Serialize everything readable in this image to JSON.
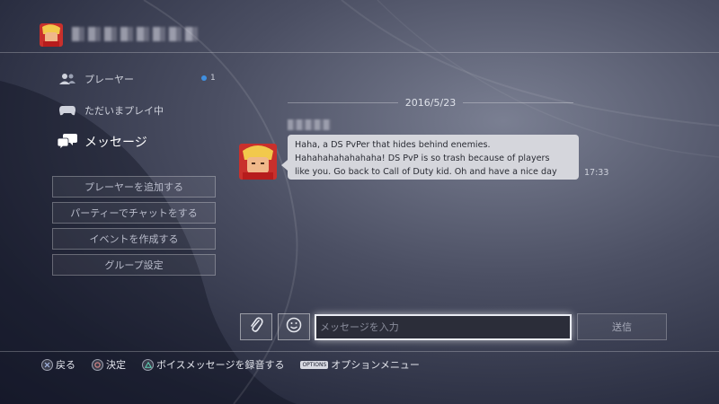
{
  "header": {
    "avatar": "ken-avatar"
  },
  "sidebar": {
    "players": {
      "label": "プレーヤー",
      "count": "1",
      "icon": "players-icon"
    },
    "now_playing": {
      "label": "ただいまプレイ中",
      "icon": "controller-icon"
    },
    "messages": {
      "label": "メッセージ",
      "icon": "message-bubbles-icon"
    },
    "buttons": [
      {
        "label": "プレーヤーを追加する"
      },
      {
        "label": "パーティーでチャットをする"
      },
      {
        "label": "イベントを作成する"
      },
      {
        "label": "グループ設定"
      }
    ]
  },
  "chat": {
    "date": "2016/5/23",
    "messages": [
      {
        "lines": [
          "Haha, a DS PvPer that hides behind enemies.",
          "Hahahahahahahaha! DS PvP is so trash because of players",
          "like you. Go back to Call of Duty kid. Oh and have a nice day"
        ],
        "time": "17:33"
      }
    ]
  },
  "composer": {
    "placeholder": "メッセージを入力",
    "send_label": "送信",
    "attach_icon": "paperclip-icon",
    "sticker_icon": "smiley-icon"
  },
  "hints": [
    {
      "button": "cross",
      "label": "戻る"
    },
    {
      "button": "circle",
      "label": "決定"
    },
    {
      "button": "triangle",
      "label": "ボイスメッセージを録音する"
    },
    {
      "button": "options",
      "glyph": "OPTIONS",
      "label": "オプションメニュー"
    }
  ],
  "colors": {
    "accent": "#3f8fe0",
    "bubble": "#d5d6dc",
    "input_bg": "#2b2d39"
  }
}
